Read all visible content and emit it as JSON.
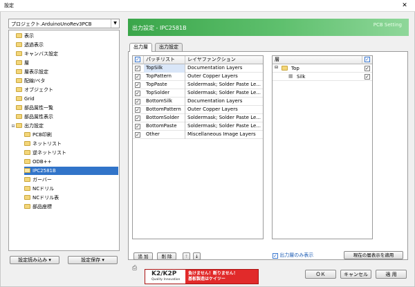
{
  "window": {
    "title": "設定",
    "close_glyph": "✕"
  },
  "project": {
    "selected": "プロジェクト.ArduinoUnoRev3PCB"
  },
  "tree": {
    "items": [
      {
        "label": "表示",
        "level": 0
      },
      {
        "label": "透過表示",
        "level": 0
      },
      {
        "label": "キャンバス設定",
        "level": 0
      },
      {
        "label": "層",
        "level": 0
      },
      {
        "label": "層表示設定",
        "level": 0
      },
      {
        "label": "配線/ベタ",
        "level": 0
      },
      {
        "label": "オブジェクト",
        "level": 0
      },
      {
        "label": "Grid",
        "level": 0
      },
      {
        "label": "部品属性一覧",
        "level": 0
      },
      {
        "label": "部品属性表示",
        "level": 0
      },
      {
        "label": "出力設定",
        "level": 0,
        "expanded": true
      },
      {
        "label": "PCB印刷",
        "level": 1
      },
      {
        "label": "ネットリスト",
        "level": 1
      },
      {
        "label": "逆ネットリスト",
        "level": 1
      },
      {
        "label": "ODB++",
        "level": 1
      },
      {
        "label": "IPC2581B",
        "level": 1,
        "selected": true
      },
      {
        "label": "ガーバー",
        "level": 1
      },
      {
        "label": "NCドリル",
        "level": 1
      },
      {
        "label": "NCドリル表",
        "level": 1
      },
      {
        "label": "部品座標",
        "level": 1
      }
    ]
  },
  "bottom_left": {
    "load": "設定読み込み",
    "save": "設定保存"
  },
  "header": {
    "title": "出力設定 - IPC2581B",
    "subtitle": "PCB Setting"
  },
  "tabs": [
    {
      "label": "出力層",
      "active": true
    },
    {
      "label": "出力設定",
      "active": false
    }
  ],
  "grid": {
    "headers": {
      "check": "✓",
      "patch": "パッチリスト",
      "function": "レイヤファンクション"
    },
    "rows": [
      {
        "checked": true,
        "patch": "TopSilk",
        "function": "Documentation Layers",
        "selected": true
      },
      {
        "checked": true,
        "patch": "TopPattern",
        "function": "Outer Copper Layers"
      },
      {
        "checked": true,
        "patch": "TopPaste",
        "function": "Soldermask; Solder Paste Le..."
      },
      {
        "checked": true,
        "patch": "TopSolder",
        "function": "Soldermask; Solder Paste Le..."
      },
      {
        "checked": true,
        "patch": "BottomSilk",
        "function": "Documentation Layers"
      },
      {
        "checked": true,
        "patch": "BottomPattern",
        "function": "Outer Copper Layers"
      },
      {
        "checked": true,
        "patch": "BottomSolder",
        "function": "Soldermask; Solder Paste Le..."
      },
      {
        "checked": true,
        "patch": "BottomPaste",
        "function": "Soldermask; Solder Paste Le..."
      },
      {
        "checked": true,
        "patch": "Other",
        "function": "Miscellaneous Image Layers"
      }
    ],
    "add": "追 加",
    "delete": "削 除",
    "up": "↑",
    "down": "↓"
  },
  "layers": {
    "header": "層",
    "check_header": "✓",
    "items": [
      {
        "label": "Top",
        "checked": true
      },
      {
        "label": "Silk",
        "checked": true
      }
    ]
  },
  "output_only": {
    "label": "出力層のみ表示",
    "checked": true
  },
  "apply_view": "現在の層表示を適用",
  "dialog": {
    "ok": "ＯＫ",
    "cancel": "キャンセル",
    "apply": "適 用"
  },
  "banner": {
    "logo": "K2/K2P",
    "tagline": "Quality Innovation",
    "line1": "負けません！断りません！",
    "line2": "基板製造はケイツー"
  },
  "colors": {
    "accent": "#3aa64a",
    "selection": "#3174c9",
    "banner": "#e12a2a"
  }
}
